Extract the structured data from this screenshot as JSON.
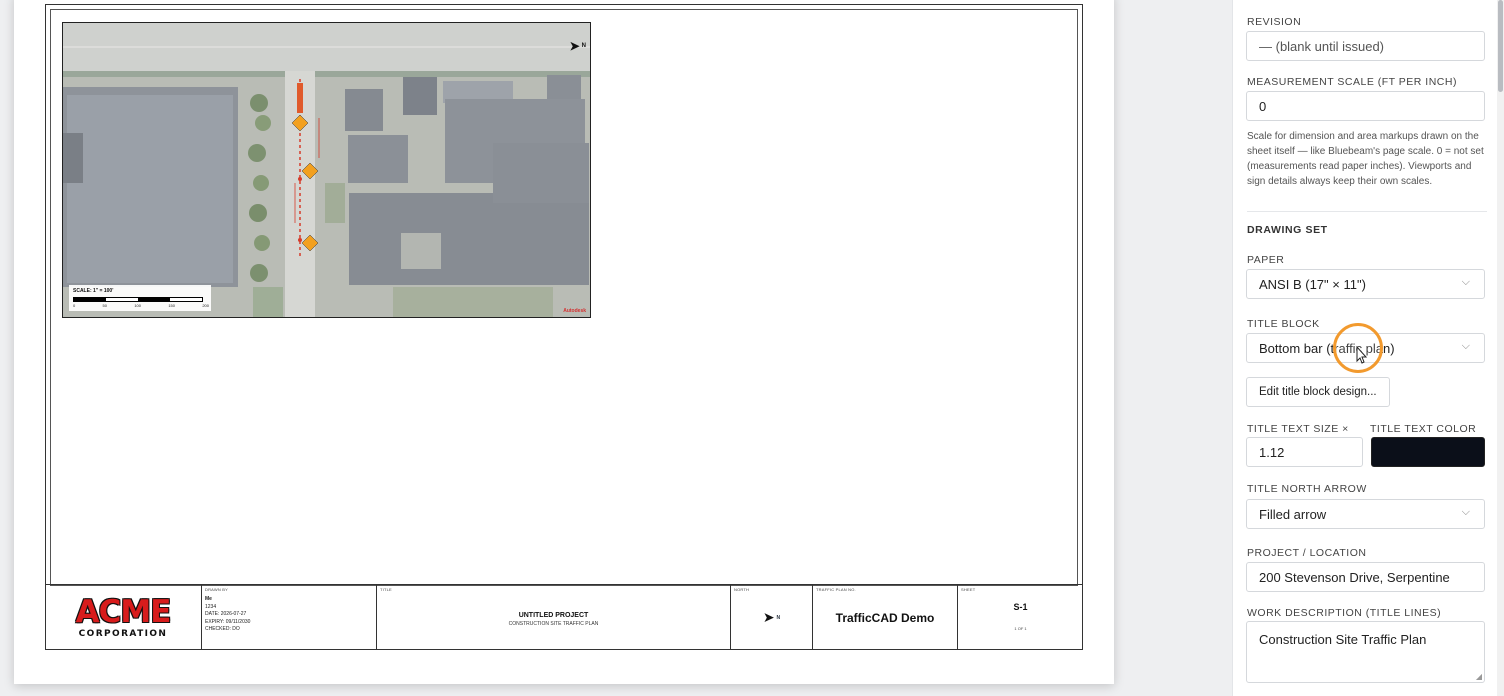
{
  "sheet": {
    "viewport": {
      "north_letter": "N",
      "scale_label": "SCALE: 1\" = 100'",
      "scale_ticks": [
        "0",
        "50",
        "100",
        "150",
        "200"
      ],
      "credit": "Autodesk"
    },
    "title_block": {
      "logo_big": "ACME",
      "logo_small": "CORPORATION",
      "drawn_by_header": "DRAWN BY",
      "drawn_by_lines": [
        "Me",
        "1234",
        "DATE: 2026-07-27",
        "EXPIRY: 09/11/2030",
        "CHECKED: DO"
      ],
      "title_header": "TITLE",
      "project": "UNTITLED PROJECT",
      "work": "CONSTRUCTION SITE TRAFFIC PLAN",
      "north_header": "NORTH",
      "north_letter": "N",
      "plan_header": "TRAFFIC PLAN No.",
      "plan_value": "TrafficCAD Demo",
      "sheet_header": "SHEET",
      "sheet_number": "S-1",
      "sheet_of": "1 OF 1"
    }
  },
  "panel": {
    "revision_label": "REVISION",
    "revision_placeholder": "— (blank until issued)",
    "scale_label": "MEASUREMENT SCALE (FT PER INCH)",
    "scale_value": "0",
    "scale_help": "Scale for dimension and area markups drawn on the sheet itself — like Bluebeam's page scale. 0 = not set (measurements read paper inches). Viewports and sign details always keep their own scales.",
    "drawing_set_label": "DRAWING SET",
    "paper_label": "PAPER",
    "paper_value": "ANSI B (17\" × 11\")",
    "title_block_label": "TITLE BLOCK",
    "title_block_value": "Bottom bar (traffic plan)",
    "edit_title_block_button": "Edit title block design...",
    "title_text_size_label": "TITLE TEXT SIZE ×",
    "title_text_size_value": "1.12",
    "title_text_color_label": "TITLE TEXT COLOR",
    "title_text_color": "#0b0f19",
    "north_arrow_label": "TITLE NORTH ARROW",
    "north_arrow_value": "Filled arrow",
    "project_location_label": "PROJECT / LOCATION",
    "project_location_value": "200 Stevenson Drive, Serpentine",
    "work_description_label": "WORK DESCRIPTION (TITLE LINES)",
    "work_description_value": "Construction Site Traffic Plan"
  },
  "colors": {
    "cursor_ring": "#f29a2e",
    "logo_red": "#d81c1c"
  }
}
